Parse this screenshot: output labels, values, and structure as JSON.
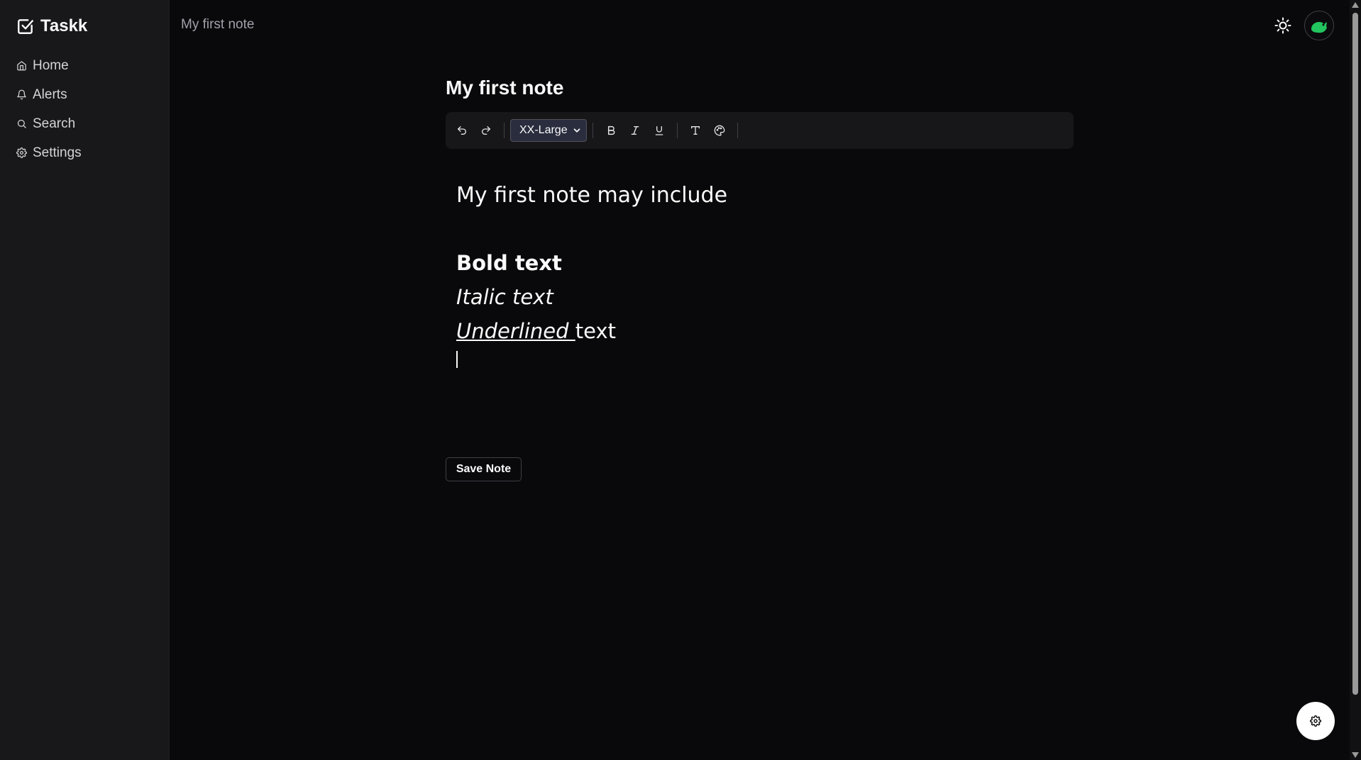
{
  "app": {
    "name": "Taskk",
    "logo_icon": "square-check-icon"
  },
  "sidebar": {
    "items": [
      {
        "label": "Home",
        "icon": "home-icon"
      },
      {
        "label": "Alerts",
        "icon": "bell-icon"
      },
      {
        "label": "Search",
        "icon": "search-icon"
      },
      {
        "label": "Settings",
        "icon": "gear-icon"
      }
    ]
  },
  "header": {
    "breadcrumb": "My first note",
    "theme_icon": "sun-icon",
    "avatar_icon": "avatar-icon"
  },
  "editor": {
    "title": "My first note",
    "toolbar": {
      "font_size": "XX-Large",
      "buttons": [
        "undo-icon",
        "redo-icon",
        "bold-icon",
        "italic-icon",
        "underline-icon",
        "text-type-icon",
        "palette-icon"
      ]
    },
    "content": {
      "line1": "My first note may include",
      "bold": "Bold text",
      "italic": "Italic text",
      "underlined": "Underlined ",
      "after_underlined": "text"
    },
    "save_label": "Save Note"
  },
  "fab": {
    "icon": "gear-icon"
  },
  "colors": {
    "background": "#09090b",
    "sidebar": "#18181b",
    "accent": "#22c55e"
  }
}
